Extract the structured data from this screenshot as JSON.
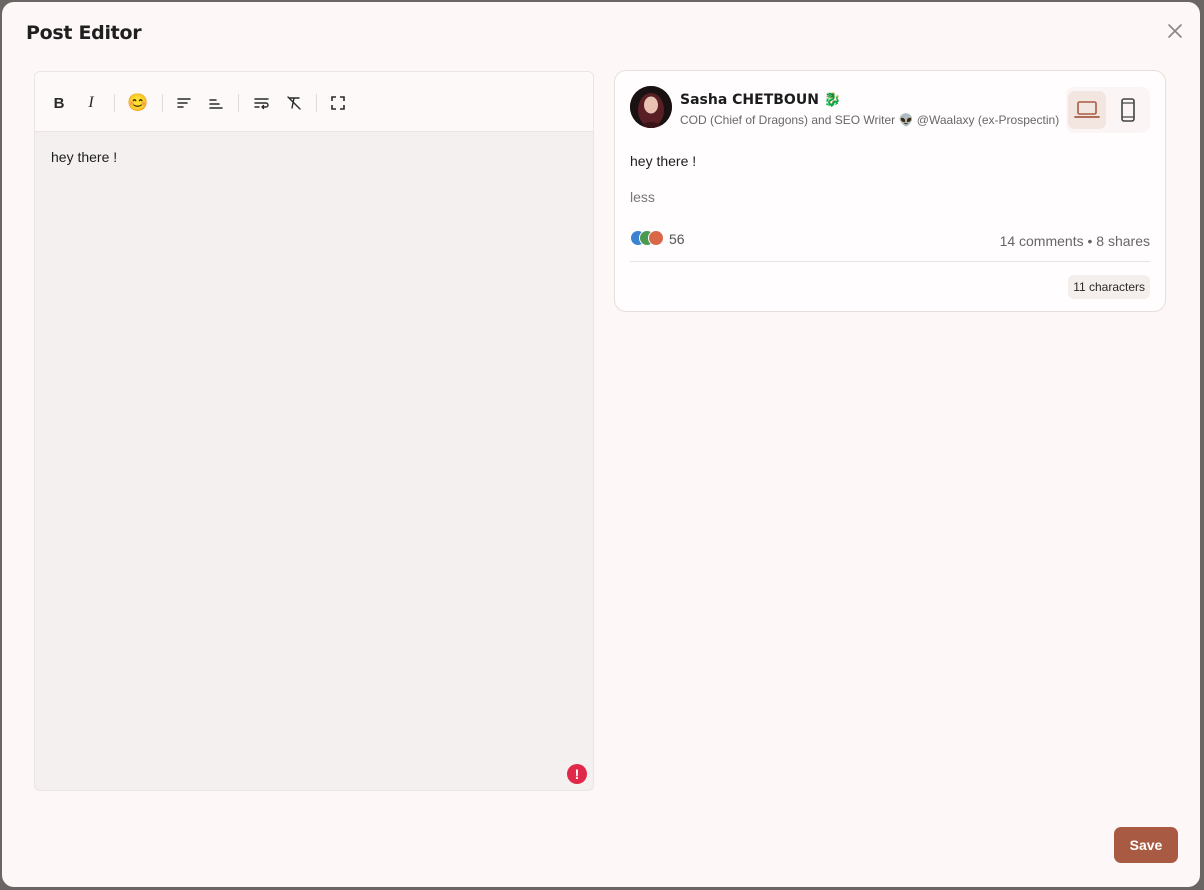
{
  "modal": {
    "title": "Post Editor"
  },
  "toolbar": {
    "buttons": [
      {
        "name": "bold",
        "glyph": "B"
      },
      {
        "name": "italic",
        "glyph": "I"
      },
      {
        "name": "emoji",
        "glyph": "😊"
      }
    ]
  },
  "editor": {
    "content": "hey there !",
    "error_glyph": "!"
  },
  "preview": {
    "author": {
      "name": "Sasha CHETBOUN",
      "name_emoji": "🐉",
      "headline": "COD (Chief of Dragons) and SEO Writer 👽 @Waalaxy (ex-Prospectin)"
    },
    "post_text": "hey there !",
    "less_label": "less",
    "reaction_count": "56",
    "comments": "14 comments",
    "separator": "•",
    "shares": "8 shares",
    "char_count": "11 characters",
    "device_modes": [
      "desktop",
      "mobile"
    ],
    "active_device": "desktop"
  },
  "footer": {
    "save_label": "Save"
  },
  "colors": {
    "accent": "#a85b42",
    "error": "#e0294a"
  }
}
